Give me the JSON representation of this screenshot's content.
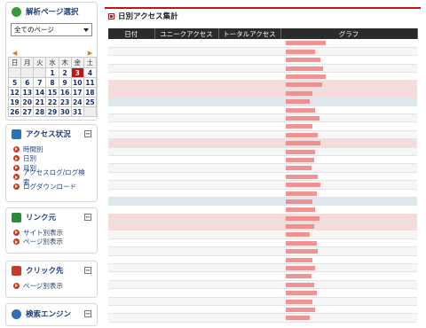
{
  "sidebar": {
    "page_select": {
      "title": "解析ページ選択",
      "selected": "全てのページ"
    },
    "calendar": {
      "weekdays": [
        "日",
        "月",
        "火",
        "水",
        "木",
        "金",
        "土"
      ],
      "weeks": [
        [
          "",
          "",
          "",
          "1",
          "2",
          "3",
          "4"
        ],
        [
          "5",
          "6",
          "7",
          "8",
          "9",
          "10",
          "11"
        ],
        [
          "12",
          "13",
          "14",
          "15",
          "16",
          "17",
          "18"
        ],
        [
          "19",
          "20",
          "21",
          "22",
          "23",
          "24",
          "25"
        ],
        [
          "26",
          "27",
          "28",
          "29",
          "30",
          "31",
          ""
        ]
      ],
      "selected_day": "3"
    },
    "access": {
      "title": "アクセス状況",
      "items": [
        "時間別",
        "日別",
        "月別",
        "アクセスログ/ログ検索",
        "ログダウンロード"
      ]
    },
    "links": {
      "title": "リンク元",
      "items": [
        "サイト別表示",
        "ページ別表示"
      ]
    },
    "clicks": {
      "title": "クリック先",
      "items": [
        "ページ別表示"
      ]
    },
    "search": {
      "title": "検索エンジン"
    }
  },
  "main": {
    "title": "日別アクセス集計",
    "columns": [
      "日付",
      "ユニークアクセス",
      "トータルアクセス",
      "グラフ"
    ],
    "rows": [
      {
        "date": "",
        "unique": "",
        "total": "",
        "bar": 0.3
      },
      {
        "date": "",
        "unique": "",
        "total": "",
        "bar": 0.22
      },
      {
        "date": "",
        "unique": "",
        "total": "",
        "bar": 0.26
      },
      {
        "date": "",
        "unique": "",
        "total": "",
        "bar": 0.28
      },
      {
        "date": "",
        "unique": "",
        "total": "",
        "bar": 0.3
      },
      {
        "date": "",
        "unique": "",
        "total": "",
        "bar": 0.27
      },
      {
        "date": "",
        "unique": "",
        "total": "",
        "bar": 0.2
      },
      {
        "date": "",
        "unique": "",
        "total": "",
        "bar": 0.18
      },
      {
        "date": "",
        "unique": "",
        "total": "",
        "bar": 0.22
      },
      {
        "date": "",
        "unique": "",
        "total": "",
        "bar": 0.25
      },
      {
        "date": "",
        "unique": "",
        "total": "",
        "bar": 0.2
      },
      {
        "date": "",
        "unique": "",
        "total": "",
        "bar": 0.24
      },
      {
        "date": "",
        "unique": "",
        "total": "",
        "bar": 0.26
      },
      {
        "date": "",
        "unique": "",
        "total": "",
        "bar": 0.22
      },
      {
        "date": "",
        "unique": "",
        "total": "",
        "bar": 0.21
      },
      {
        "date": "",
        "unique": "",
        "total": "",
        "bar": 0.19
      },
      {
        "date": "",
        "unique": "",
        "total": "",
        "bar": 0.24
      },
      {
        "date": "",
        "unique": "",
        "total": "",
        "bar": 0.26
      },
      {
        "date": "",
        "unique": "",
        "total": "",
        "bar": 0.23
      },
      {
        "date": "",
        "unique": "",
        "total": "",
        "bar": 0.2
      },
      {
        "date": "",
        "unique": "",
        "total": "",
        "bar": 0.22
      },
      {
        "date": "",
        "unique": "",
        "total": "",
        "bar": 0.25
      },
      {
        "date": "",
        "unique": "",
        "total": "",
        "bar": 0.21
      },
      {
        "date": "",
        "unique": "",
        "total": "",
        "bar": 0.18
      },
      {
        "date": "",
        "unique": "",
        "total": "",
        "bar": 0.23
      },
      {
        "date": "",
        "unique": "",
        "total": "",
        "bar": 0.24
      },
      {
        "date": "",
        "unique": "",
        "total": "",
        "bar": 0.2
      },
      {
        "date": "",
        "unique": "",
        "total": "",
        "bar": 0.22
      },
      {
        "date": "",
        "unique": "",
        "total": "",
        "bar": 0.19
      },
      {
        "date": "",
        "unique": "",
        "total": "",
        "bar": 0.21
      },
      {
        "date": "",
        "unique": "",
        "total": "",
        "bar": 0.23
      },
      {
        "date": "",
        "unique": "",
        "total": "",
        "bar": 0.2
      },
      {
        "date": "",
        "unique": "",
        "total": "",
        "bar": 0.22
      },
      {
        "date": "",
        "unique": "",
        "total": "",
        "bar": 0.18
      }
    ],
    "highlight_rows": [
      5,
      6,
      12,
      21,
      22
    ],
    "blue_rows": [
      7,
      19
    ]
  },
  "colors": {
    "accent": "#c7120f",
    "header_bg": "#2b2b2b",
    "nav_text": "#1f3f7a"
  }
}
